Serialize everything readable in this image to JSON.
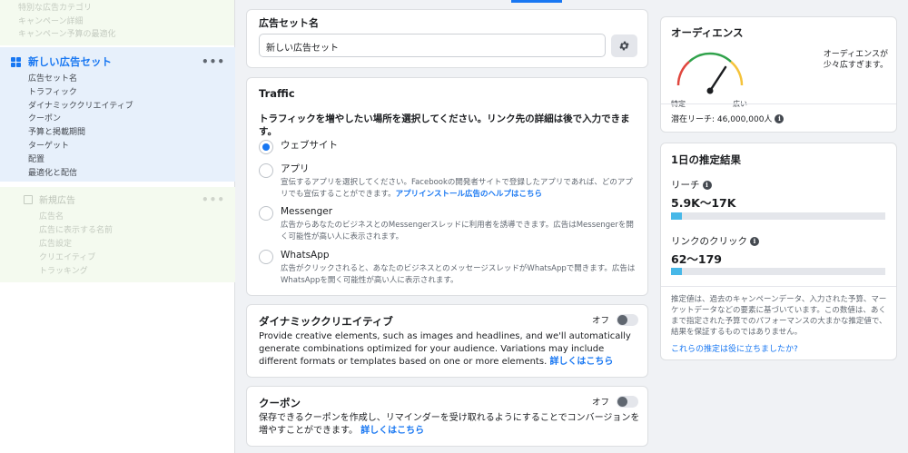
{
  "sidebar": {
    "top_items": [
      "特別な広告カテゴリ",
      "キャンペーン詳細",
      "キャンペーン予算の最適化"
    ],
    "adset": {
      "title": "新しい広告セット",
      "more": "•••",
      "items": [
        "広告セット名",
        "トラフィック",
        "ダイナミッククリエイティブ",
        "クーポン",
        "予算と掲載期間",
        "ターゲット",
        "配置",
        "最適化と配信"
      ]
    },
    "new_ad": {
      "title": "新規広告",
      "more": "•••",
      "items": [
        "広告名",
        "広告に表示する名前",
        "広告設定",
        "クリエイティブ",
        "トラッキング"
      ]
    }
  },
  "adset_name": {
    "label": "広告セット名",
    "value": "新しい広告セット"
  },
  "traffic": {
    "title": "Traffic",
    "description": "トラフィックを増やしたい場所を選択してください。リンク先の詳細は後で入力できます。",
    "options": [
      {
        "label": "ウェブサイト",
        "desc": "",
        "link": ""
      },
      {
        "label": "アプリ",
        "desc": "宣伝するアプリを選択してください。Facebookの開発者サイトで登録したアプリであれば、どのアプリでも宣伝することができます。",
        "link": "アプリインストール広告のヘルプはこちら"
      },
      {
        "label": "Messenger",
        "desc": "広告からあなたのビジネスとのMessengerスレッドに利用者を誘導できます。広告はMessengerを開く可能性が高い人に表示されます。",
        "link": ""
      },
      {
        "label": "WhatsApp",
        "desc": "広告がクリックされると、あなたのビジネスとのメッセージスレッドがWhatsAppで開きます。広告はWhatsAppを開く可能性が高い人に表示されます。",
        "link": ""
      }
    ],
    "selected": 0
  },
  "dynamic_creative": {
    "title": "ダイナミッククリエイティブ",
    "toggle_label": "オフ",
    "body": "Provide creative elements, such as images and headlines, and we'll automatically generate combinations optimized for your audience. Variations may include different formats or templates based on one or more elements.",
    "link": "詳しくはこちら"
  },
  "coupon": {
    "title": "クーポン",
    "toggle_label": "オフ",
    "body": "保存できるクーポンを作成し、リマインダーを受け取れるようにすることでコンバージョンを増やすことができます。",
    "link": "詳しくはこちら"
  },
  "audience": {
    "title": "オーディエンス",
    "note": "オーディエンスが少々広すぎます。",
    "gauge_left": "特定",
    "gauge_right": "広い",
    "reach": "潜在リーチ: 46,000,000人",
    "info": "i"
  },
  "estimates": {
    "title": "1日の推定結果",
    "reach_label": "リーチ",
    "reach_value": "5.9K〜17K",
    "reach_fill": 0.05,
    "clicks_label": "リンクのクリック",
    "clicks_value": "62〜179",
    "clicks_fill": 0.05,
    "note": "推定値は、過去のキャンペーンデータ、入力された予算、マーケットデータなどの要素に基づいています。この数値は、あくまで指定された予算でのパフォーマンスの大まかな推定値で、結果を保証するものではありません。",
    "feedback_link": "これらの推定は役に立ちましたか?",
    "info": "i"
  },
  "colors": {
    "accent": "#1877f2",
    "bar_fill": "#47b8e8",
    "gauge_red": "#e0473e",
    "gauge_green": "#30a24b",
    "gauge_yellow": "#f5c33b"
  }
}
